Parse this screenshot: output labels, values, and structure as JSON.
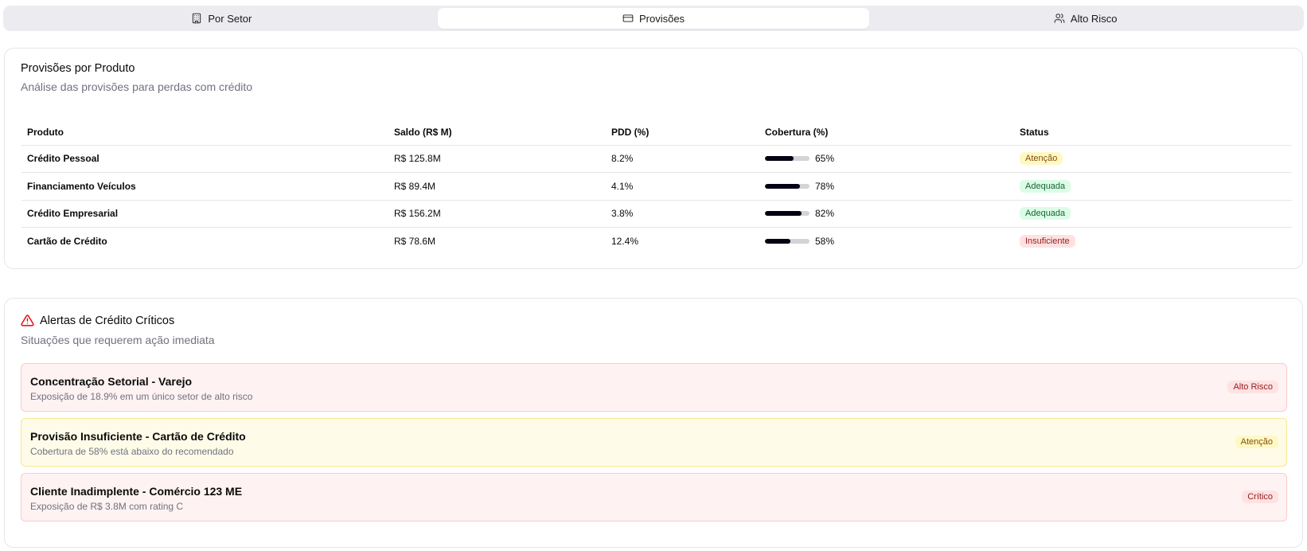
{
  "tabs": [
    {
      "label": "Por Setor",
      "icon": "building-icon",
      "active": false
    },
    {
      "label": "Provisões",
      "icon": "credit-card-icon",
      "active": true
    },
    {
      "label": "Alto Risco",
      "icon": "users-icon",
      "active": false
    }
  ],
  "provisions": {
    "title": "Provisões por Produto",
    "subtitle": "Análise das provisões para perdas com crédito",
    "headers": [
      "Produto",
      "Saldo (R$ M)",
      "PDD (%)",
      "Cobertura (%)",
      "Status"
    ],
    "rows": [
      {
        "product": "Crédito Pessoal",
        "balance": "R$ 125.8M",
        "pdd": "8.2%",
        "coverage": 65,
        "coverage_label": "65%",
        "status": "Atenção",
        "status_kind": "warn"
      },
      {
        "product": "Financiamento Veículos",
        "balance": "R$ 89.4M",
        "pdd": "4.1%",
        "coverage": 78,
        "coverage_label": "78%",
        "status": "Adequada",
        "status_kind": "ok"
      },
      {
        "product": "Crédito Empresarial",
        "balance": "R$ 156.2M",
        "pdd": "3.8%",
        "coverage": 82,
        "coverage_label": "82%",
        "status": "Adequada",
        "status_kind": "ok"
      },
      {
        "product": "Cartão de Crédito",
        "balance": "R$ 78.6M",
        "pdd": "12.4%",
        "coverage": 58,
        "coverage_label": "58%",
        "status": "Insuficiente",
        "status_kind": "bad"
      }
    ]
  },
  "alerts": {
    "title": "Alertas de Crédito Críticos",
    "subtitle": "Situações que requerem ação imediata",
    "icon": "alert-triangle-icon",
    "accent": "#e7000b",
    "items": [
      {
        "title": "Concentração Setorial - Varejo",
        "description": "Exposição de 18.9% em um único setor de alto risco",
        "badge": "Alto Risco",
        "kind": "red"
      },
      {
        "title": "Provisão Insuficiente - Cartão de Crédito",
        "description": "Cobertura de 58% está abaixo do recomendado",
        "badge": "Atenção",
        "kind": "yellow"
      },
      {
        "title": "Cliente Inadimplente - Comércio 123 ME",
        "description": "Exposição de R$ 3.8M com rating C",
        "badge": "Crítico",
        "kind": "red"
      }
    ]
  }
}
